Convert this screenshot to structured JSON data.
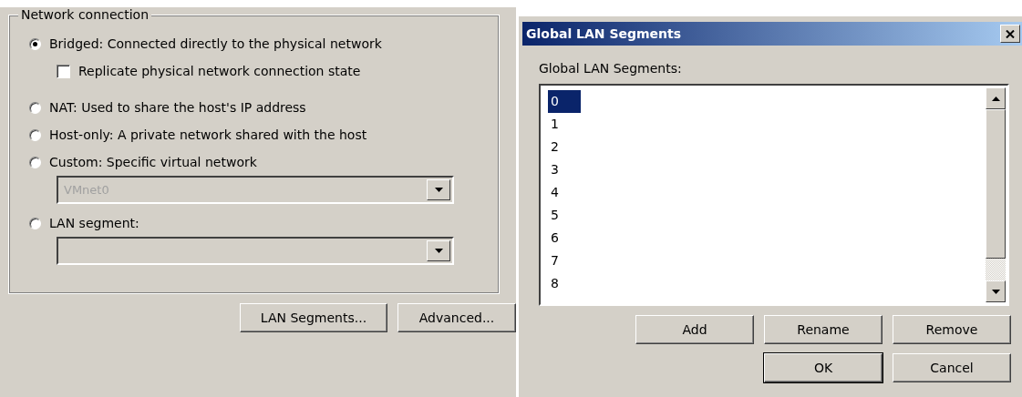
{
  "network_connection": {
    "title": "Network connection",
    "options": [
      {
        "kind": "radio",
        "label": "Bridged: Connected directly to the physical network",
        "selected": true
      },
      {
        "kind": "checkbox",
        "label": "Replicate physical network connection state",
        "checked": false
      },
      {
        "kind": "radio",
        "label": "NAT: Used to share the host's IP address",
        "selected": false
      },
      {
        "kind": "radio",
        "label": "Host-only: A private network shared with the host",
        "selected": false
      },
      {
        "kind": "radio",
        "label": "Custom: Specific virtual network",
        "selected": false
      },
      {
        "kind": "dropdown",
        "value": "VMnet0",
        "disabled": true
      },
      {
        "kind": "radio",
        "label": "LAN segment:",
        "selected": false
      },
      {
        "kind": "dropdown",
        "disabled": true
      }
    ]
  },
  "buttons": [
    "LAN Segments...",
    "Advanced..."
  ],
  "dialog": {
    "title": "Global LAN Segments",
    "list_label": "Global LAN Segments:",
    "segments": [
      {
        "label": "0",
        "selected": true
      },
      {
        "label": "1",
        "selected": false
      },
      {
        "label": "2",
        "selected": false
      },
      {
        "label": "3",
        "selected": false
      },
      {
        "label": "4",
        "selected": false
      },
      {
        "label": "5",
        "selected": false
      },
      {
        "label": "6",
        "selected": false
      },
      {
        "label": "7",
        "selected": false
      },
      {
        "label": "8",
        "selected": false
      }
    ],
    "actions": [
      "Add",
      "Rename",
      "Remove"
    ],
    "footer": [
      {
        "label": "OK",
        "default": true
      },
      {
        "label": "Cancel",
        "default": false
      }
    ]
  }
}
